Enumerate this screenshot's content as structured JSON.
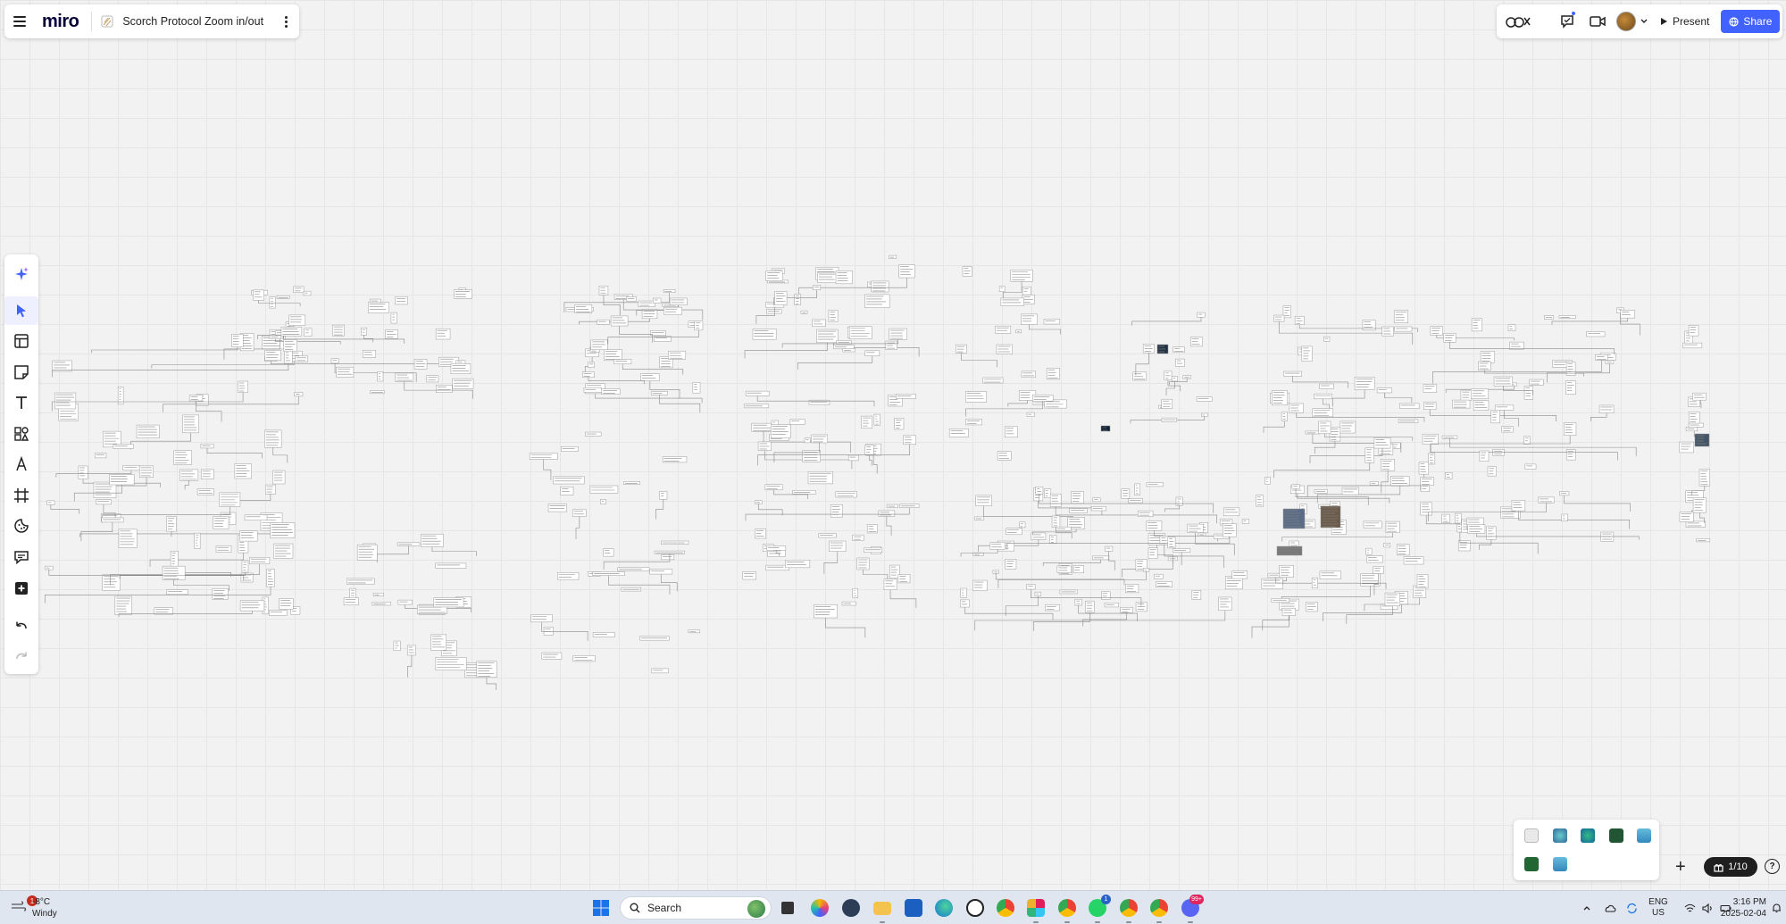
{
  "app": {
    "logo": "miro",
    "board_title": "Scorch Protocol Zoom in/out",
    "accent_color": "#4262ff"
  },
  "header": {
    "present_label": "Present",
    "share_label": "Share"
  },
  "toolbar": {
    "tools": [
      "sparkle-ai-icon",
      "select-cursor-icon",
      "templates-icon",
      "sticky-note-icon",
      "text-icon",
      "shapes-icon",
      "pen-icon",
      "frame-icon",
      "stickers-icon",
      "comment-icon",
      "more-tools-icon",
      "undo-icon",
      "redo-icon"
    ]
  },
  "bottom": {
    "frames_counter": "1/10",
    "help_label": "?"
  },
  "taskbar": {
    "weather_temp": "-8°C",
    "weather_condition": "Windy",
    "weather_badge": "1",
    "search_label": "Search",
    "lang_line1": "ENG",
    "lang_line2": "US",
    "time": "3:16 PM",
    "date": "2025-02-04",
    "badges": {
      "whatsapp": "1",
      "discord": "99+"
    }
  }
}
